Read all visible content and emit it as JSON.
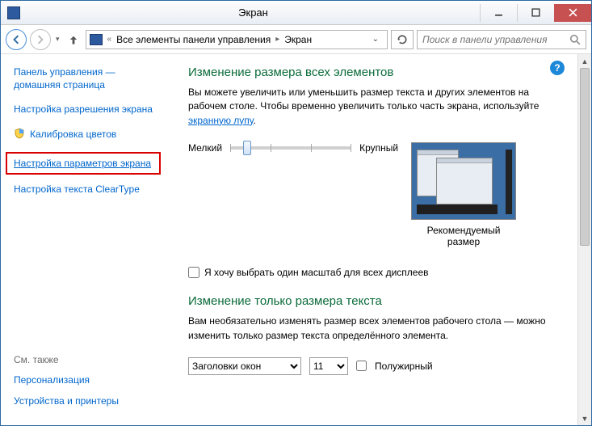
{
  "titlebar": {
    "title": "Экран"
  },
  "toolbar": {
    "breadcrumb_root": "Все элементы панели управления",
    "breadcrumb_current": "Экран",
    "search_placeholder": "Поиск в панели управления"
  },
  "sidebar": {
    "items": [
      {
        "label": "Панель управления — домашняя страница"
      },
      {
        "label": "Настройка разрешения экрана"
      },
      {
        "label": "Калибровка цветов",
        "shield": true
      },
      {
        "label": "Настройка параметров экрана",
        "highlighted": true
      },
      {
        "label": "Настройка текста ClearType"
      }
    ],
    "see_also_heading": "См. также",
    "see_also": [
      {
        "label": "Персонализация"
      },
      {
        "label": "Устройства и принтеры"
      }
    ]
  },
  "main": {
    "heading1": "Изменение размера всех элементов",
    "desc_part1": "Вы можете увеличить или уменьшить размер текста и других элементов на рабочем столе. Чтобы временно увеличить только часть экрана, используйте ",
    "desc_link": "экранную лупу",
    "desc_part2": ".",
    "slider_min": "Мелкий",
    "slider_max": "Крупный",
    "preview_caption": "Рекомендуемый размер",
    "checkbox_label": "Я хочу выбрать один масштаб для всех дисплеев",
    "heading2": "Изменение только размера текста",
    "desc2": "Вам необязательно изменять размер всех элементов рабочего стола — можно изменить только размер текста определённого элемента.",
    "element_select": {
      "value": "Заголовки окон",
      "options": [
        "Заголовки окон"
      ]
    },
    "size_select": {
      "value": "11",
      "options": [
        "11"
      ]
    },
    "bold_label": "Полужирный"
  }
}
